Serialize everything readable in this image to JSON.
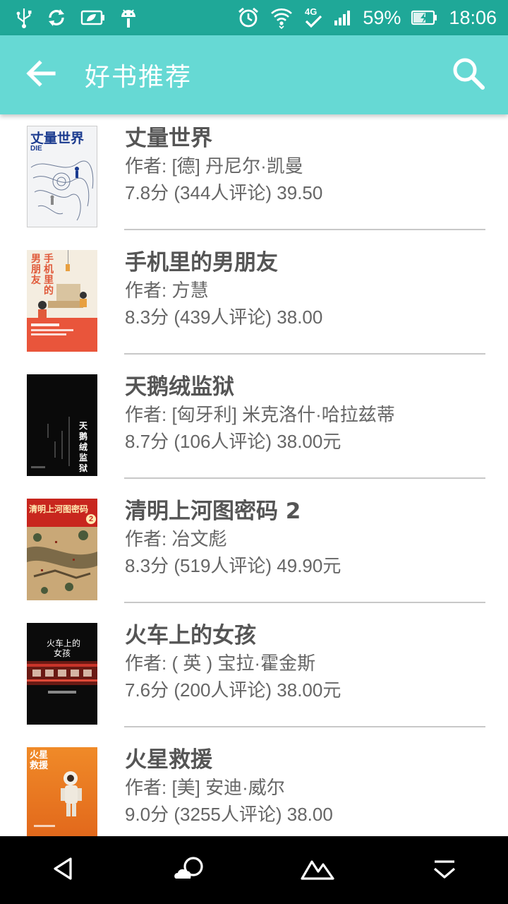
{
  "status_bar": {
    "battery": "59%",
    "time": "18:06",
    "network": "4G",
    "icons": [
      "usb-icon",
      "sync-icon",
      "battery-saver-icon",
      "android-icon",
      "alarm-icon",
      "wifi-icon",
      "network-4g-icon",
      "signal-icon",
      "battery-icon"
    ]
  },
  "app_bar": {
    "title": "好书推荐",
    "back_icon": "arrow-left-icon",
    "search_icon": "search-icon"
  },
  "books": [
    {
      "title": "丈量世界",
      "author": "作者: [德] 丹尼尔·凯曼",
      "stats": "7.8分 (344人评论)  39.50",
      "cover": {
        "lines": [
          "丈量世界",
          "DIE"
        ]
      }
    },
    {
      "title": "手机里的男朋友",
      "author": "作者: 方慧",
      "stats": "8.3分 (439人评论)  38.00",
      "cover": {
        "lines": [
          "男",
          "朋",
          "友",
          "手",
          "机",
          "里",
          "的"
        ]
      }
    },
    {
      "title": "天鹅绒监狱",
      "author": "作者: [匈牙利] 米克洛什·哈拉兹蒂",
      "stats": "8.7分 (106人评论)  38.00元",
      "cover": {
        "lines": [
          "天",
          "鹅",
          "绒",
          "监",
          "狱"
        ]
      }
    },
    {
      "title": "清明上河图密码 2",
      "author": "作者: 冶文彪",
      "stats": "8.3分 (519人评论)  49.90元",
      "cover": {
        "lines": [
          "清明上河图密码",
          "2"
        ]
      }
    },
    {
      "title": "火车上的女孩",
      "author": "作者: ( 英 ) 宝拉·霍金斯",
      "stats": "7.6分 (200人评论)  38.00元",
      "cover": {
        "lines": [
          "火车上的",
          "女孩"
        ]
      }
    },
    {
      "title": "火星救援",
      "author": "作者: [美] 安迪·威尔",
      "stats": "9.0分 (3255人评论)  38.00",
      "cover": {
        "lines": [
          "火星",
          "救援"
        ]
      }
    }
  ],
  "nav_bar": {
    "icons": [
      "back-triangle-icon",
      "cloud-home-icon",
      "mountain-icon",
      "menu-down-icon"
    ]
  },
  "colors": {
    "status_bar": "#1fa898",
    "app_bar": "#66d9d4",
    "title_text": "#555555",
    "meta_text": "#666666",
    "divider": "#c8c8c8"
  }
}
